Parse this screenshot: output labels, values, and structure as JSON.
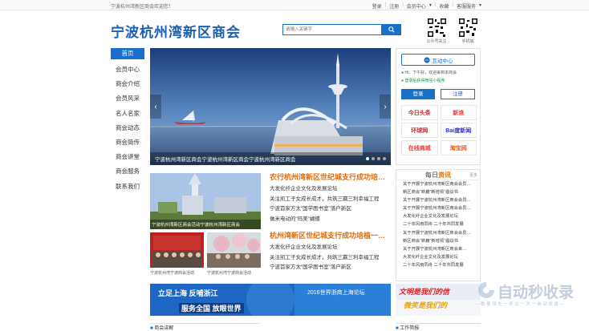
{
  "topbar": {
    "welcome": "宁波杭州湾新区商会欢迎您！",
    "login": "登录",
    "register": "注册",
    "member_center": "会员中心",
    "collect": "收藏",
    "service": "客服服务"
  },
  "header": {
    "logo": "宁波杭州湾新区商会",
    "search_placeholder": "请输入关键字",
    "qr1_label": "公众号关注",
    "qr2_label": "手机端"
  },
  "nav": {
    "items": [
      "首页",
      "会员中心",
      "商会介绍",
      "会员风采",
      "名人名家",
      "商会动态",
      "商会简传",
      "商会讲堂",
      "商会服务",
      "联系我们"
    ]
  },
  "banner": {
    "caption": "宁波杭州湾新区商会宁波杭州湾新区商会宁波杭州湾新区商会",
    "prev": "‹",
    "next": "›"
  },
  "userbox": {
    "interact": "互动中心",
    "greeting": "Hi，下午好，欢迎来到本商会",
    "wechat": "登录后获得微信小程序",
    "login": "登录",
    "register": "注册",
    "partners": [
      "今日头条",
      "新浪",
      "环球网",
      "Bai度新闻",
      "在线商城",
      "淘宝网"
    ]
  },
  "thumbs": {
    "big_label": "宁波杭州湾新区商会活动宁波杭州湾新区商会",
    "cap1": "宁波杭州湾宁波商会活动",
    "cap2": "宁波杭州湾宁波商会活动"
  },
  "news1": {
    "headline": "农行杭州湾新区世纪城支行成功培…",
    "lines": [
      "大发化纤企业文化及发展论坛",
      "关注凯工子女成长成才，共筑三嬴三利幸福工程",
      "宁波首家方太“国学图书室”落户新区",
      "做米电动的“玛美”蝴蝶"
    ]
  },
  "news2": {
    "headline": "杭州湾新区世纪城支行成功培植一…",
    "lines": [
      "大发化纤企业文化及发展论坛",
      "关注凯工子女成长成才，共筑三嬴三利幸福工程",
      "宁波首家方太“国学图书室”落户新区"
    ]
  },
  "daily": {
    "title_prefix": "每日",
    "title_suffix": "资讯",
    "more": "更多",
    "lines": [
      "关于开展宁波杭州湾新区商会会员…",
      "新区商会“新篇”新增领“倡议书",
      "关于开展宁波杭州湾新区商会会员…",
      "关于开展宁波杭州湾新区商会会员…",
      "大发化纤企业文化及发展论坛",
      "二十年风雨同舟 二十年共同发展",
      "关于开展宁波杭州湾新区商会会员…",
      "新区商会“新篇”新增领“倡议书",
      "关于开展宁波杭州湾新区商会来…",
      "大发化纤企业文化及发展论坛",
      "二十年风雨同舟 二十年共同发展"
    ]
  },
  "ads": {
    "ad1_top": "立足上海 反哺浙江",
    "ad1_bottom": "服务全国 放眼世界",
    "ad1_right": "2016世界浙商上海论坛",
    "ad2_top": "文明是我们的信",
    "ad2_bottom": "微笑是我们的"
  },
  "bottom": {
    "tab1": "商会讲解",
    "tab2": "工作简报"
  },
  "watermark": {
    "text": "自动秒收录",
    "sub": "---  数 量 领 先 一 来 访 一 次 一 自 动 收 录  ---"
  }
}
